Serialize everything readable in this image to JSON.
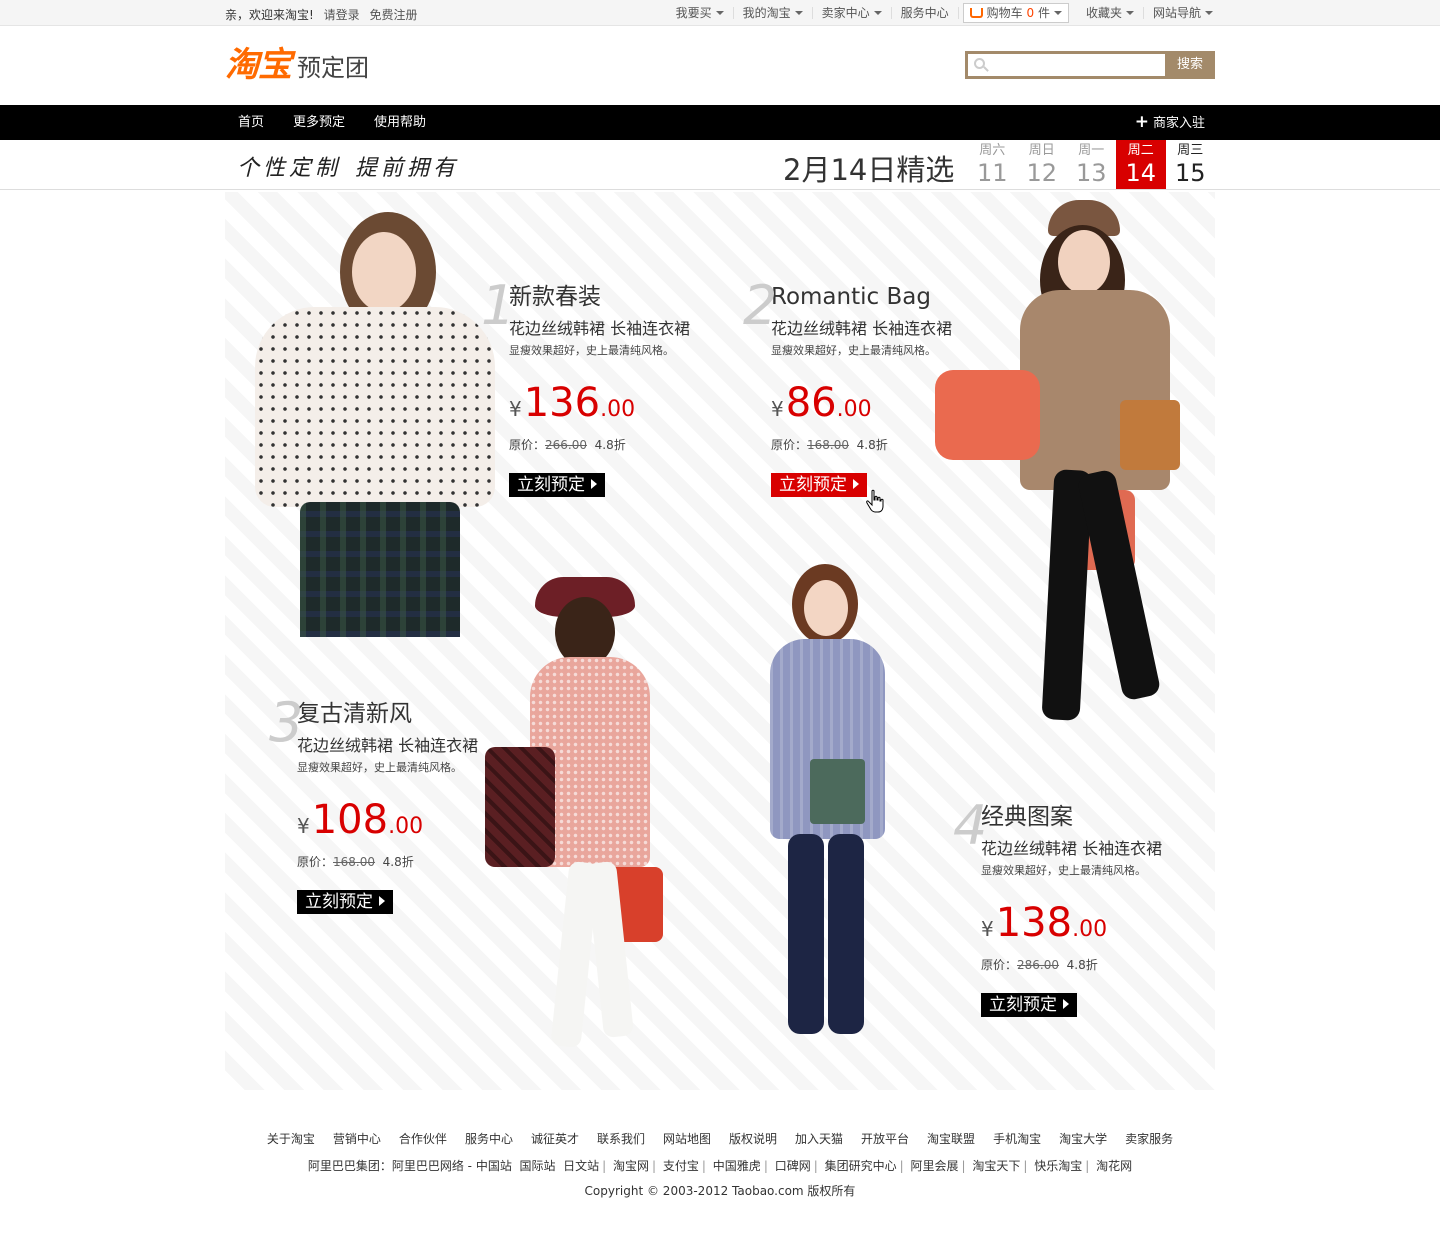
{
  "topbar": {
    "welcome": "亲，欢迎来淘宝!",
    "login": "请登录",
    "register": "免费注册",
    "items": [
      "我要买",
      "我的淘宝",
      "卖家中心",
      "服务中心"
    ],
    "cart_label": "购物车",
    "cart_count": "0",
    "cart_unit": "件",
    "favorites": "收藏夹",
    "site_nav": "网站导航"
  },
  "header": {
    "brand": "淘宝",
    "subtitle": "预定团",
    "search_button": "搜索",
    "search_placeholder": ""
  },
  "nav": {
    "items": [
      "首页",
      "更多预定",
      "使用帮助"
    ],
    "merchant": "商家入驻"
  },
  "datestrip": {
    "slogan_1": "个性定制",
    "slogan_2": "提前拥有",
    "title": "2月14日精选",
    "days": [
      {
        "weekday": "周六",
        "date": "11"
      },
      {
        "weekday": "周日",
        "date": "12"
      },
      {
        "weekday": "周一",
        "date": "13"
      },
      {
        "weekday": "周二",
        "date": "14"
      },
      {
        "weekday": "周三",
        "date": "15"
      }
    ],
    "active_index": 3
  },
  "products": [
    {
      "num": "1",
      "title": "新款春装",
      "desc": "花边丝绒韩裙 长袖连衣裙",
      "tip": "显瘦效果超好，史上最清纯风格。",
      "currency": "¥",
      "price_int": "136",
      "price_dec": ".00",
      "orig_label": "原价：",
      "orig_price": "266.00",
      "discount": "4.8折",
      "buy": "立刻预定"
    },
    {
      "num": "2",
      "title": "Romantic Bag",
      "desc": "花边丝绒韩裙 长袖连衣裙",
      "tip": "显瘦效果超好，史上最清纯风格。",
      "currency": "¥",
      "price_int": "86",
      "price_dec": ".00",
      "orig_label": "原价：",
      "orig_price": "168.00",
      "discount": "4.8折",
      "buy": "立刻预定"
    },
    {
      "num": "3",
      "title": "复古清新风",
      "desc": "花边丝绒韩裙 长袖连衣裙",
      "tip": "显瘦效果超好，史上最清纯风格。",
      "currency": "¥",
      "price_int": "108",
      "price_dec": ".00",
      "orig_label": "原价：",
      "orig_price": "168.00",
      "discount": "4.8折",
      "buy": "立刻预定"
    },
    {
      "num": "4",
      "title": "经典图案",
      "desc": "花边丝绒韩裙 长袖连衣裙",
      "tip": "显瘦效果超好，史上最清纯风格。",
      "currency": "¥",
      "price_int": "138",
      "price_dec": ".00",
      "orig_label": "原价：",
      "orig_price": "286.00",
      "discount": "4.8折",
      "buy": "立刻预定"
    }
  ],
  "footer": {
    "links": [
      "关于淘宝",
      "营销中心",
      "合作伙伴",
      "服务中心",
      "诚征英才",
      "联系我们",
      "网站地图",
      "版权说明",
      "加入天猫",
      "开放平台",
      "淘宝联盟",
      "手机淘宝",
      "淘宝大学",
      "卖家服务"
    ],
    "group_label": "阿里巴巴集团：",
    "group_first": "阿里巴巴网络 - 中国站",
    "group_first_extra": [
      "国际站",
      "日文站"
    ],
    "group_links": [
      "淘宝网",
      "支付宝",
      "中国雅虎",
      "口碑网",
      "集团研究中心",
      "阿里会展",
      "淘宝天下",
      "快乐淘宝",
      "淘花网"
    ],
    "copyright": "Copyright © 2003-2012 Taobao.com 版权所有"
  },
  "colors": {
    "accent": "#d80000",
    "brand": "#ff6a00",
    "search": "#a38a6a"
  }
}
